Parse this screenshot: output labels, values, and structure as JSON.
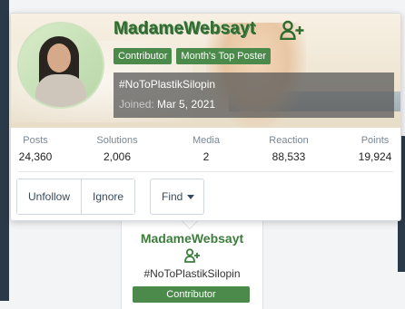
{
  "profile": {
    "username": "MadameWebsayt",
    "badges": [
      "Contributor",
      "Month's Top Poster"
    ],
    "tagline": "#NoToPlastikSilopin",
    "joined_label": "Joined:",
    "joined_date": "Mar 5, 2021",
    "follow_icon": "user-plus-icon"
  },
  "stats": [
    {
      "label": "Posts",
      "value": "24,360"
    },
    {
      "label": "Solutions",
      "value": "2,006"
    },
    {
      "label": "Media",
      "value": "2"
    },
    {
      "label": "Reaction",
      "value": "88,533"
    },
    {
      "label": "Points",
      "value": "19,924"
    }
  ],
  "actions": {
    "unfollow": "Unfollow",
    "ignore": "Ignore",
    "find": "Find"
  },
  "background_card": {
    "username": "MadameWebsayt",
    "tagline": "#NoToPlastikSilopin",
    "badge": "Contributor"
  },
  "colors": {
    "accent_green": "#4c8a4c",
    "username_green": "#2f6b2f"
  }
}
